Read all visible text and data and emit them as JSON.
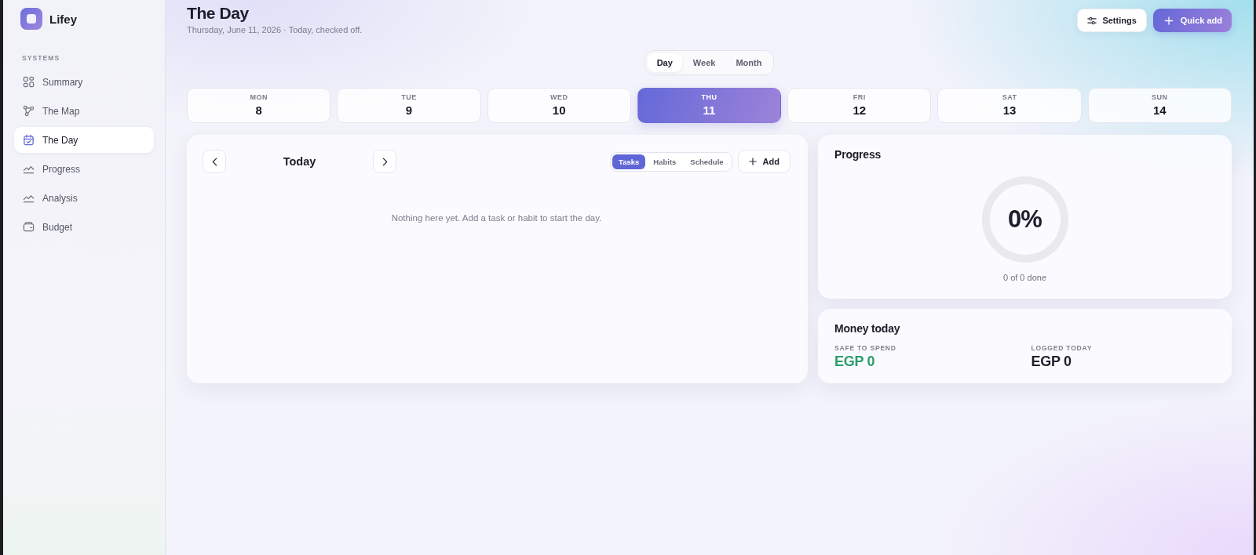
{
  "sidebar": {
    "brand": "Lifey",
    "section_label": "SYSTEMS",
    "items": [
      {
        "label": "Summary",
        "selected": false
      },
      {
        "label": "The Map",
        "selected": false
      },
      {
        "label": "The Day",
        "selected": true
      },
      {
        "label": "Progress",
        "selected": false
      },
      {
        "label": "Analysis",
        "selected": false
      },
      {
        "label": "Budget",
        "selected": false
      }
    ]
  },
  "header": {
    "title": "The Day",
    "subtitle": "Thursday, June 11, 2026 · Today, checked off.",
    "settings_button": "Settings",
    "quick_add_button": "Quick add"
  },
  "view_switch": [
    {
      "label": "Day",
      "selected": true
    },
    {
      "label": "Week",
      "selected": false
    },
    {
      "label": "Month",
      "selected": false
    }
  ],
  "week_strip": [
    {
      "weekday": "MON",
      "date": "8",
      "selected": false
    },
    {
      "weekday": "TUE",
      "date": "9",
      "selected": false
    },
    {
      "weekday": "WED",
      "date": "10",
      "selected": false
    },
    {
      "weekday": "THU",
      "date": "11",
      "selected": true
    },
    {
      "weekday": "FRI",
      "date": "12",
      "selected": false
    },
    {
      "weekday": "SAT",
      "date": "13",
      "selected": false
    },
    {
      "weekday": "SUN",
      "date": "14",
      "selected": false
    }
  ],
  "day_panel": {
    "title": "Today",
    "tabs": [
      {
        "label": "Tasks",
        "selected": true
      },
      {
        "label": "Habits",
        "selected": false
      },
      {
        "label": "Schedule",
        "selected": false
      }
    ],
    "add_button": "Add",
    "empty_message": "Nothing here yet. Add a task or habit to start the day."
  },
  "progress": {
    "title": "Progress",
    "level": 0,
    "percent": "0%",
    "caption": "0 of 0 done"
  },
  "money": {
    "title": "Money today",
    "stats": [
      {
        "label": "SAFE TO SPEND",
        "value": "EGP 0",
        "color": "#2a9d6a"
      },
      {
        "label": "LOGGED TODAY",
        "value": "EGP 0",
        "color": "#1e1f2c"
      }
    ]
  }
}
